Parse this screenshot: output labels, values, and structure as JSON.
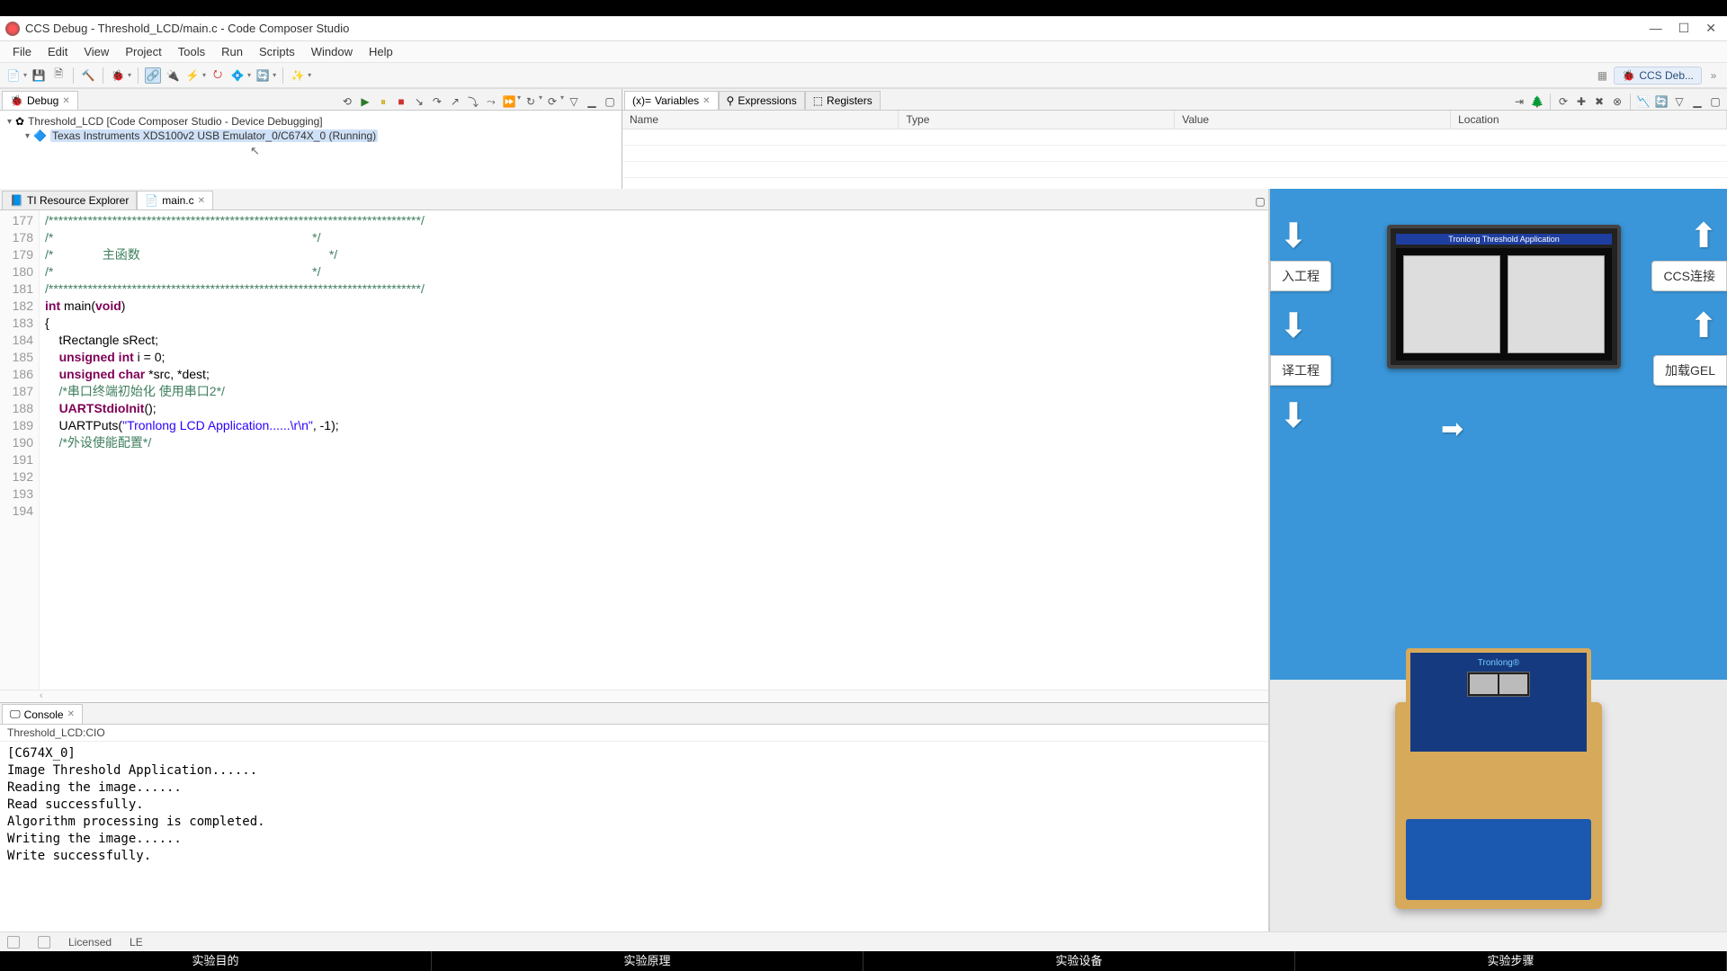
{
  "window": {
    "title": "CCS Debug - Threshold_LCD/main.c - Code Composer Studio"
  },
  "menu": [
    "File",
    "Edit",
    "View",
    "Project",
    "Tools",
    "Run",
    "Scripts",
    "Window",
    "Help"
  ],
  "perspective": {
    "label": "CCS Deb..."
  },
  "debug_pane": {
    "title": "Debug",
    "root": "Threshold_LCD [Code Composer Studio - Device Debugging]",
    "child": "Texas Instruments XDS100v2 USB Emulator_0/C674X_0 (Running)"
  },
  "vars_pane": {
    "tabs": [
      "Variables",
      "Expressions",
      "Registers"
    ],
    "columns": [
      "Name",
      "Type",
      "Value",
      "Location"
    ]
  },
  "editor": {
    "tabs": [
      "TI Resource Explorer",
      "main.c"
    ],
    "first_line": 177,
    "lines": [
      {
        "t": "comment",
        "text": "/****************************************************************************/"
      },
      {
        "t": "comment",
        "text": "/*                                                                          */"
      },
      {
        "t": "comment",
        "text": "/*              主函数                                                      */"
      },
      {
        "t": "comment",
        "text": "/*                                                                          */"
      },
      {
        "t": "comment",
        "text": "/****************************************************************************/"
      },
      {
        "t": "sig",
        "raw": "int main(void)"
      },
      {
        "t": "plain",
        "text": "{"
      },
      {
        "t": "plain",
        "text": "    tRectangle sRect;"
      },
      {
        "t": "plain",
        "text": ""
      },
      {
        "t": "decl_uint",
        "text": "    unsigned int i = 0;"
      },
      {
        "t": "decl_uchar",
        "text": "    unsigned char *src, *dest;"
      },
      {
        "t": "plain",
        "text": ""
      },
      {
        "t": "comment",
        "text": "    /*串口终端初始化 使用串口2*/"
      },
      {
        "t": "call",
        "text": "    UARTStdioInit();"
      },
      {
        "t": "plain",
        "text": ""
      },
      {
        "t": "puts",
        "pre": "    UARTPuts(",
        "str": "\"Tronlong LCD Application......\\r\\n\"",
        "post": ", -1);"
      },
      {
        "t": "plain",
        "text": ""
      },
      {
        "t": "comment",
        "text": "    /*外设使能配置*/"
      }
    ]
  },
  "console": {
    "title": "Console",
    "subtitle": "Threshold_LCD:CIO",
    "lines": [
      "[C674X_0]",
      "Image Threshold Application......",
      "Reading the image......",
      "Read successfully.",
      "Algorithm processing is completed.",
      "Writing the image......",
      "Write successfully."
    ]
  },
  "statusbar": {
    "license": "Licensed",
    "encoding": "LE"
  },
  "media": {
    "lcd_title": "Tronlong Threshold Application",
    "flow_boxes": [
      "入工程",
      "CCS连接",
      "译工程",
      "加载GEL"
    ],
    "kit_brand": "Tronlong®"
  },
  "lesson_tabs": [
    "实验目的",
    "实验原理",
    "实验设备",
    "实验步骤"
  ]
}
